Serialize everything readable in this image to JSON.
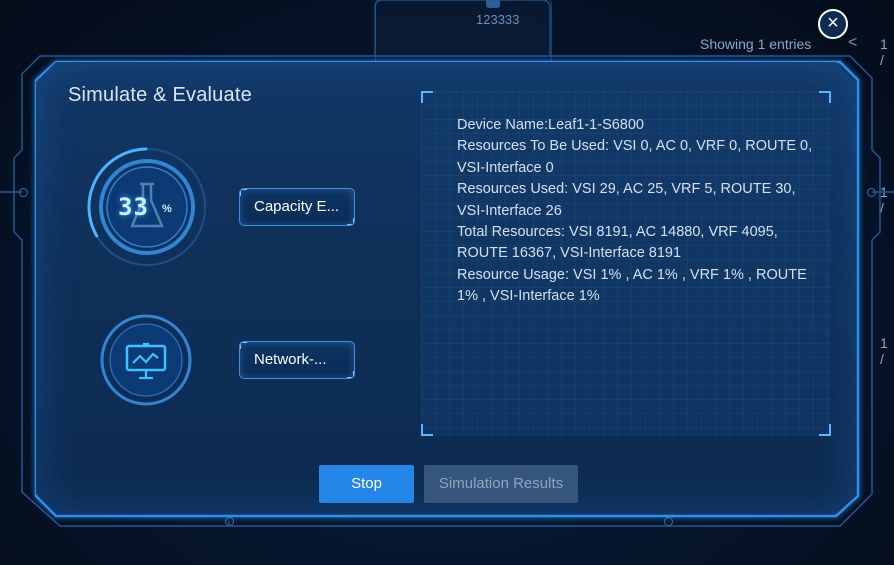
{
  "background": {
    "card_label": "123333",
    "entries_text": "Showing 1 entries",
    "chevron": "<",
    "page_indicators": [
      "1 /",
      "1 /",
      "1 /"
    ]
  },
  "modal": {
    "title": "Simulate & Evaluate",
    "close_icon": "×",
    "capacity": {
      "value": "33",
      "unit": "%",
      "fraction": 0.33,
      "icon": "flask-icon",
      "button_label": "Capacity E..."
    },
    "network": {
      "icon": "monitor-chart-icon",
      "button_label": "Network-..."
    },
    "info": {
      "lines": [
        "Device Name:Leaf1-1-S6800",
        "Resources To Be Used: VSI 0, AC 0, VRF 0, ROUTE 0, VSI-Interface 0",
        "Resources Used: VSI 29, AC 25, VRF 5, ROUTE 30, VSI-Interface 26",
        "Total Resources: VSI 8191, AC 14880, VRF 4095, ROUTE 16367, VSI-Interface 8191",
        "Resource Usage: VSI 1% , AC 1% , VRF 1% , ROUTE 1% , VSI-Interface 1%"
      ]
    },
    "buttons": {
      "stop": "Stop",
      "results": "Simulation Results"
    }
  },
  "colors": {
    "accent": "#2386e8",
    "frame_glow": "#3aa8ff",
    "disabled_button": "#35557d"
  }
}
